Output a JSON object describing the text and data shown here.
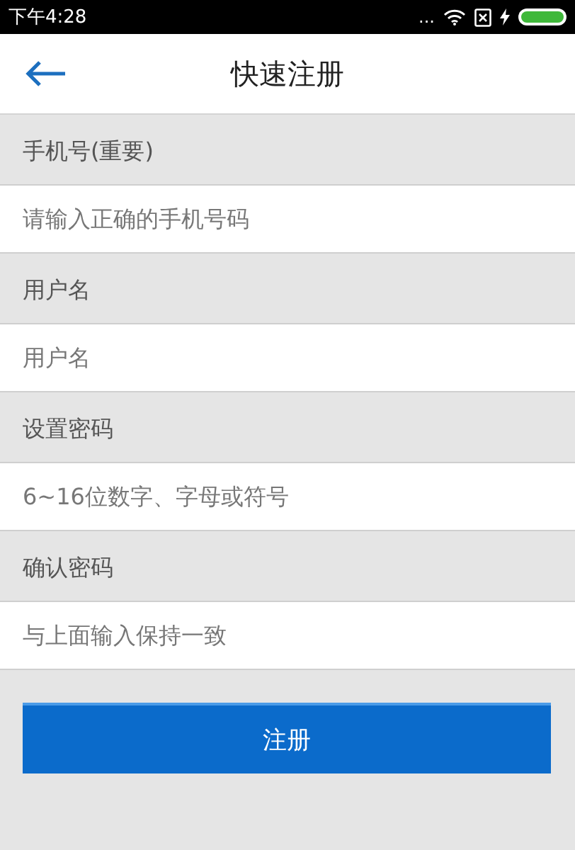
{
  "status_bar": {
    "time": "下午4:28",
    "dots": "..."
  },
  "header": {
    "title": "快速注册"
  },
  "fields": [
    {
      "label": "手机号(重要)",
      "placeholder": "请输入正确的手机号码"
    },
    {
      "label": "用户名",
      "placeholder": "用户名"
    },
    {
      "label": "设置密码",
      "placeholder": "6~16位数字、字母或符号"
    },
    {
      "label": "确认密码",
      "placeholder": "与上面输入保持一致"
    }
  ],
  "submit": {
    "label": "注册"
  }
}
